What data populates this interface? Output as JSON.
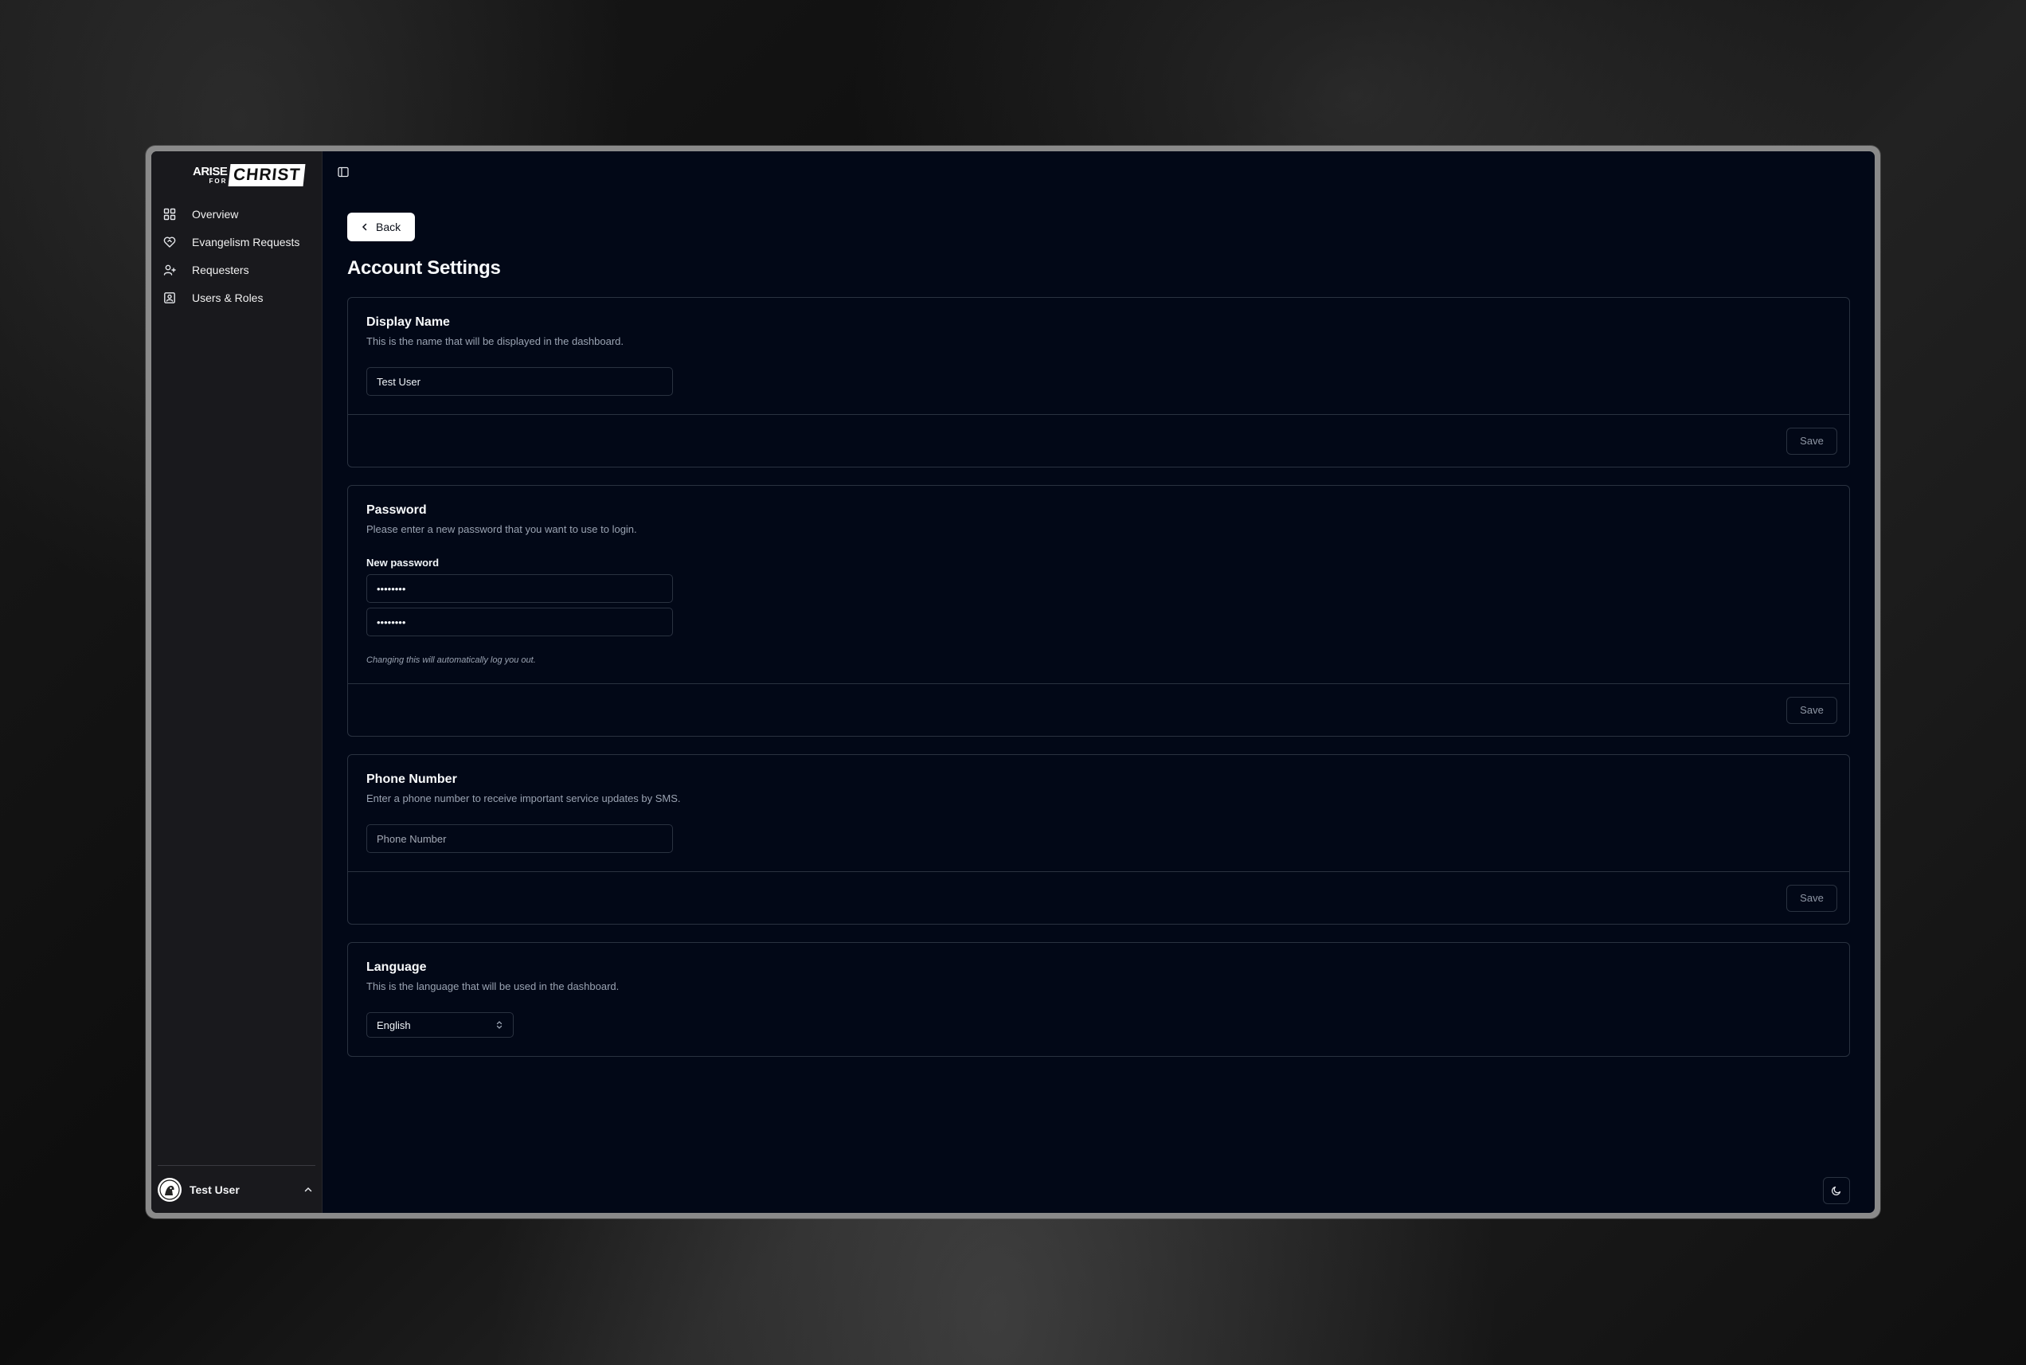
{
  "brand": {
    "logo_top": "ARISE",
    "logo_sub": "FOR",
    "logo_box": "CHRIST"
  },
  "sidebar": {
    "items": [
      {
        "label": "Overview",
        "icon": "grid-icon"
      },
      {
        "label": "Evangelism Requests",
        "icon": "heart-handshake-icon"
      },
      {
        "label": "Requesters",
        "icon": "user-plus-icon"
      },
      {
        "label": "Users & Roles",
        "icon": "contact-icon"
      }
    ],
    "user": {
      "name": "Test User"
    }
  },
  "main": {
    "back_label": "Back",
    "page_title": "Account Settings",
    "display_name": {
      "title": "Display Name",
      "description": "This is the name that will be displayed in the dashboard.",
      "value": "Test User",
      "save_label": "Save"
    },
    "password": {
      "title": "Password",
      "description": "Please enter a new password that you want to use to login.",
      "field_label": "New password",
      "value1": "••••••••",
      "value2": "••••••••",
      "hint": "Changing this will automatically log you out.",
      "save_label": "Save"
    },
    "phone": {
      "title": "Phone Number",
      "description": "Enter a phone number to receive important service updates by SMS.",
      "placeholder": "Phone Number",
      "save_label": "Save"
    },
    "language": {
      "title": "Language",
      "description": "This is the language that will be used in the dashboard.",
      "selected": "English"
    }
  }
}
